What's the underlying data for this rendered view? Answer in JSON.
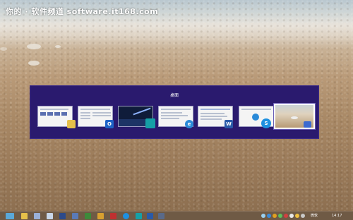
{
  "watermark": "你的 · 软件频道 software.it168.com",
  "switcher": {
    "title": "桌面",
    "windows": [
      {
        "name": "explorer-window",
        "badge": "icon"
      },
      {
        "name": "outlook-window",
        "badge": "O"
      },
      {
        "name": "photos-window",
        "badge": "icon"
      },
      {
        "name": "ie-window",
        "badge": "e"
      },
      {
        "name": "word-window",
        "badge": "W"
      },
      {
        "name": "sogou-window",
        "badge": "S"
      },
      {
        "name": "desktop-window",
        "badge": "icon",
        "selected": true
      }
    ]
  },
  "taskbar": {
    "lang": "微软",
    "time": "14:17"
  },
  "colors": {
    "switcher_bg": "#2a1a6e",
    "taskbar_bg": "#6f5a45",
    "outlook_blue": "#1e63c6",
    "word_blue": "#2a5aa8",
    "ie_blue": "#2a8ad8",
    "sogou_blue": "#1e90e0",
    "photos_teal": "#16a0a6"
  }
}
